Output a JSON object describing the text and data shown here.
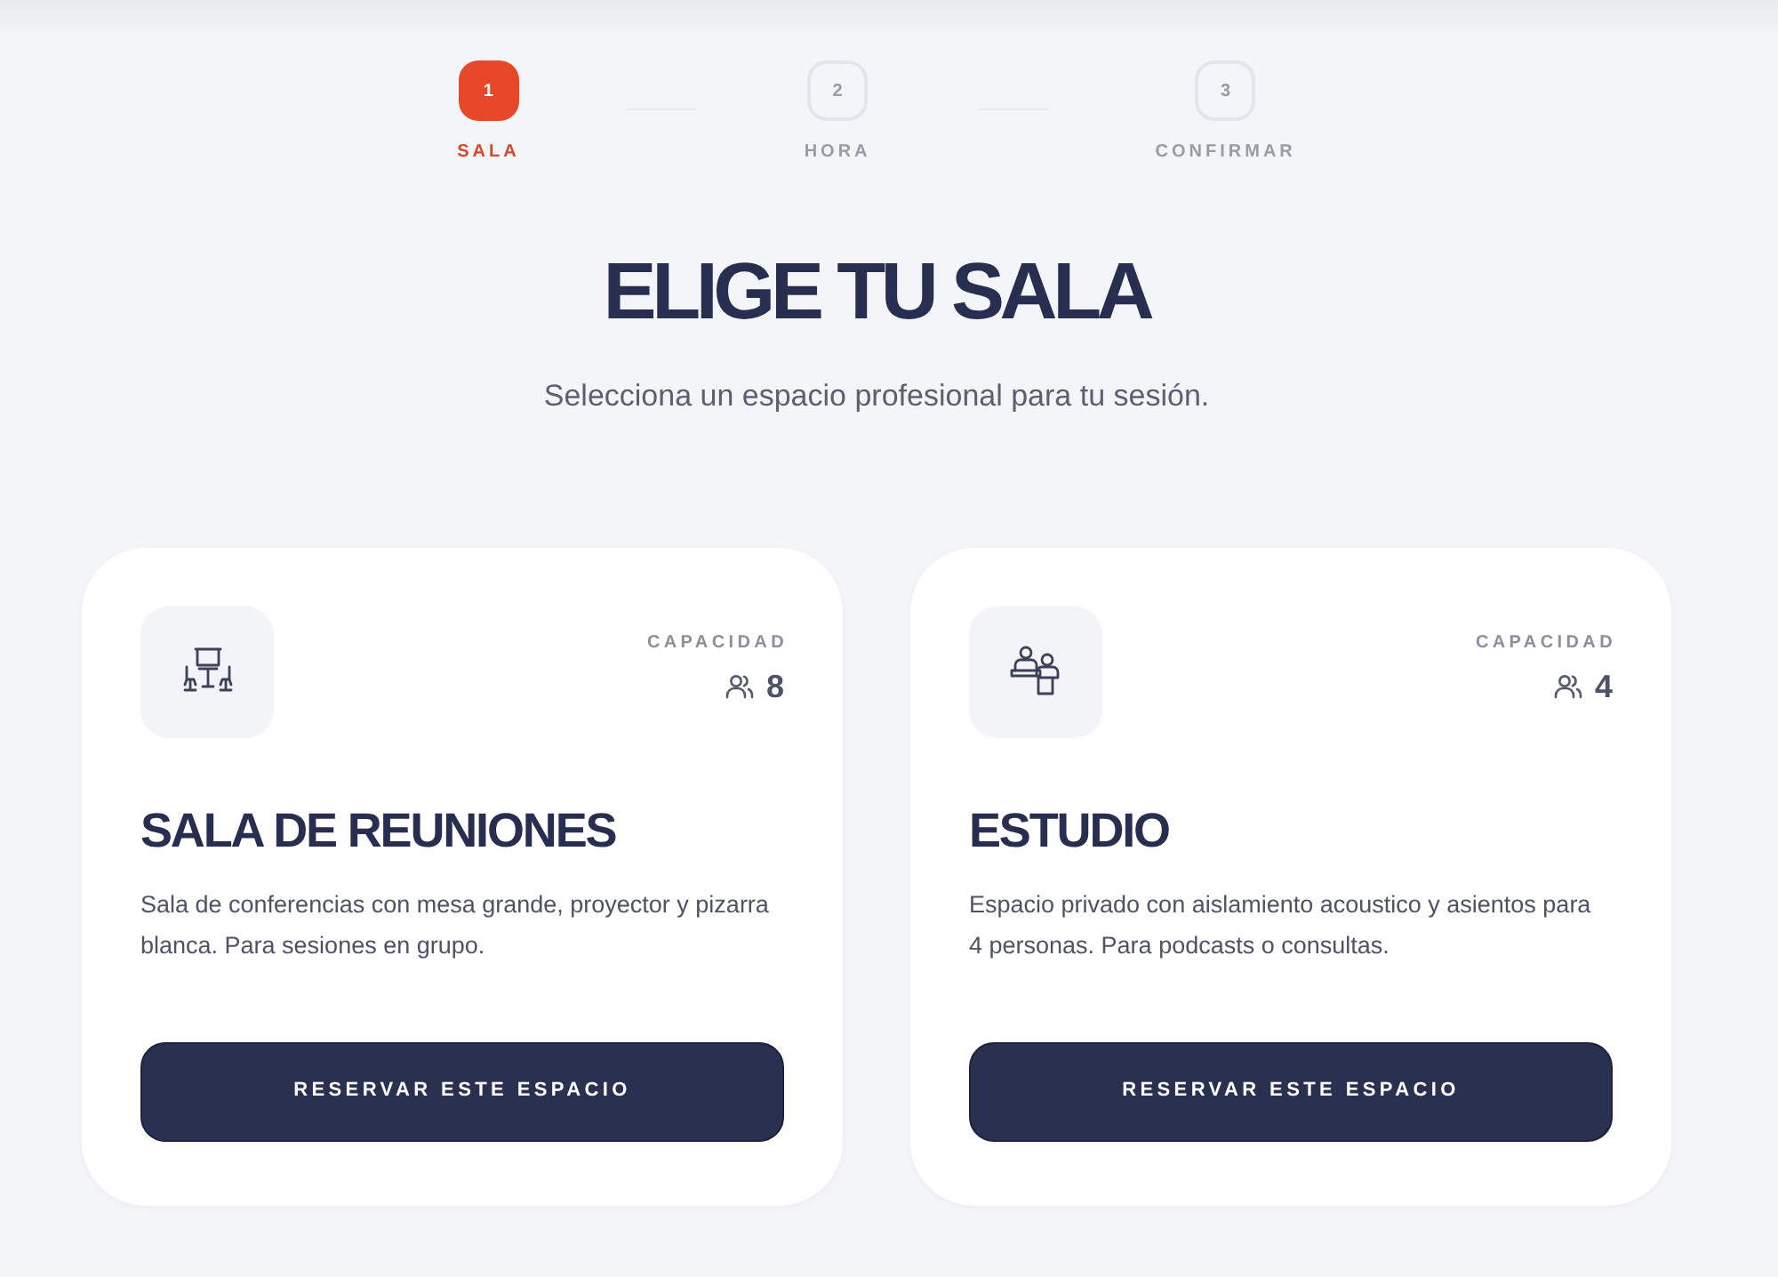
{
  "stepper": {
    "steps": [
      {
        "number": "1",
        "label": "SALA",
        "selected": true
      },
      {
        "number": "2",
        "label": "HORA",
        "selected": false
      },
      {
        "number": "3",
        "label": "CONFIRMAR",
        "selected": false
      }
    ]
  },
  "heading": {
    "title": "ELIGE TU SALA",
    "subtitle": "Selecciona un espacio profesional para tu sesión."
  },
  "rooms": [
    {
      "kind": "meeting",
      "capacity_label": "CAPACIDAD",
      "capacity": "8",
      "name": "SALA DE REUNIONES",
      "description": "Sala de conferencias con mesa grande, proyector y pizarra blanca. Para sesiones en grupo.",
      "button": "RESERVAR ESTE ESPACIO"
    },
    {
      "kind": "studio",
      "capacity_label": "CAPACIDAD",
      "capacity": "4",
      "name": "ESTUDIO",
      "description": "Espacio privado con aislamiento acoustico y asientos para 4 personas. Para podcasts o consultas.",
      "button": "RESERVAR ESTE ESPACIO"
    }
  ]
}
